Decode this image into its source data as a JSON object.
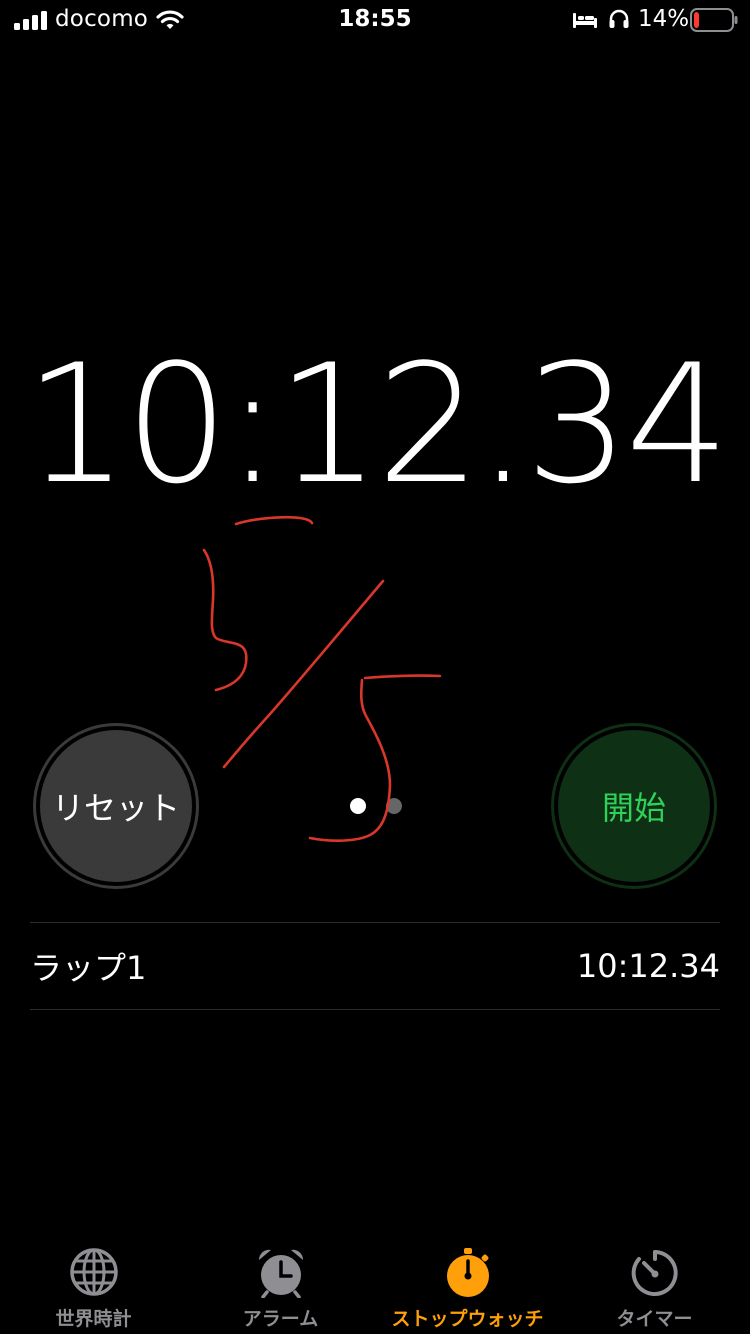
{
  "status_bar": {
    "carrier": "docomo",
    "time": "18:55",
    "battery_percent": "14%",
    "battery_level": 0.14,
    "battery_color": "#ff3b30"
  },
  "stopwatch": {
    "elapsed": "10:12.34"
  },
  "controls": {
    "reset_label": "リセット",
    "start_label": "開始",
    "start_color": "#30d158"
  },
  "pager": {
    "total": 2,
    "current": 1
  },
  "laps": [
    {
      "name": "ラップ1",
      "time": "10:12.34"
    }
  ],
  "tab_bar": {
    "selected_color": "#ff9f0a",
    "items": [
      {
        "label": "世界時計",
        "icon": "globe-icon"
      },
      {
        "label": "アラーム",
        "icon": "alarm-clock-icon"
      },
      {
        "label": "ストップウォッチ",
        "icon": "stopwatch-icon",
        "selected": true
      },
      {
        "label": "タイマー",
        "icon": "timer-icon"
      }
    ]
  },
  "annotation": {
    "color": "#d9372b"
  }
}
